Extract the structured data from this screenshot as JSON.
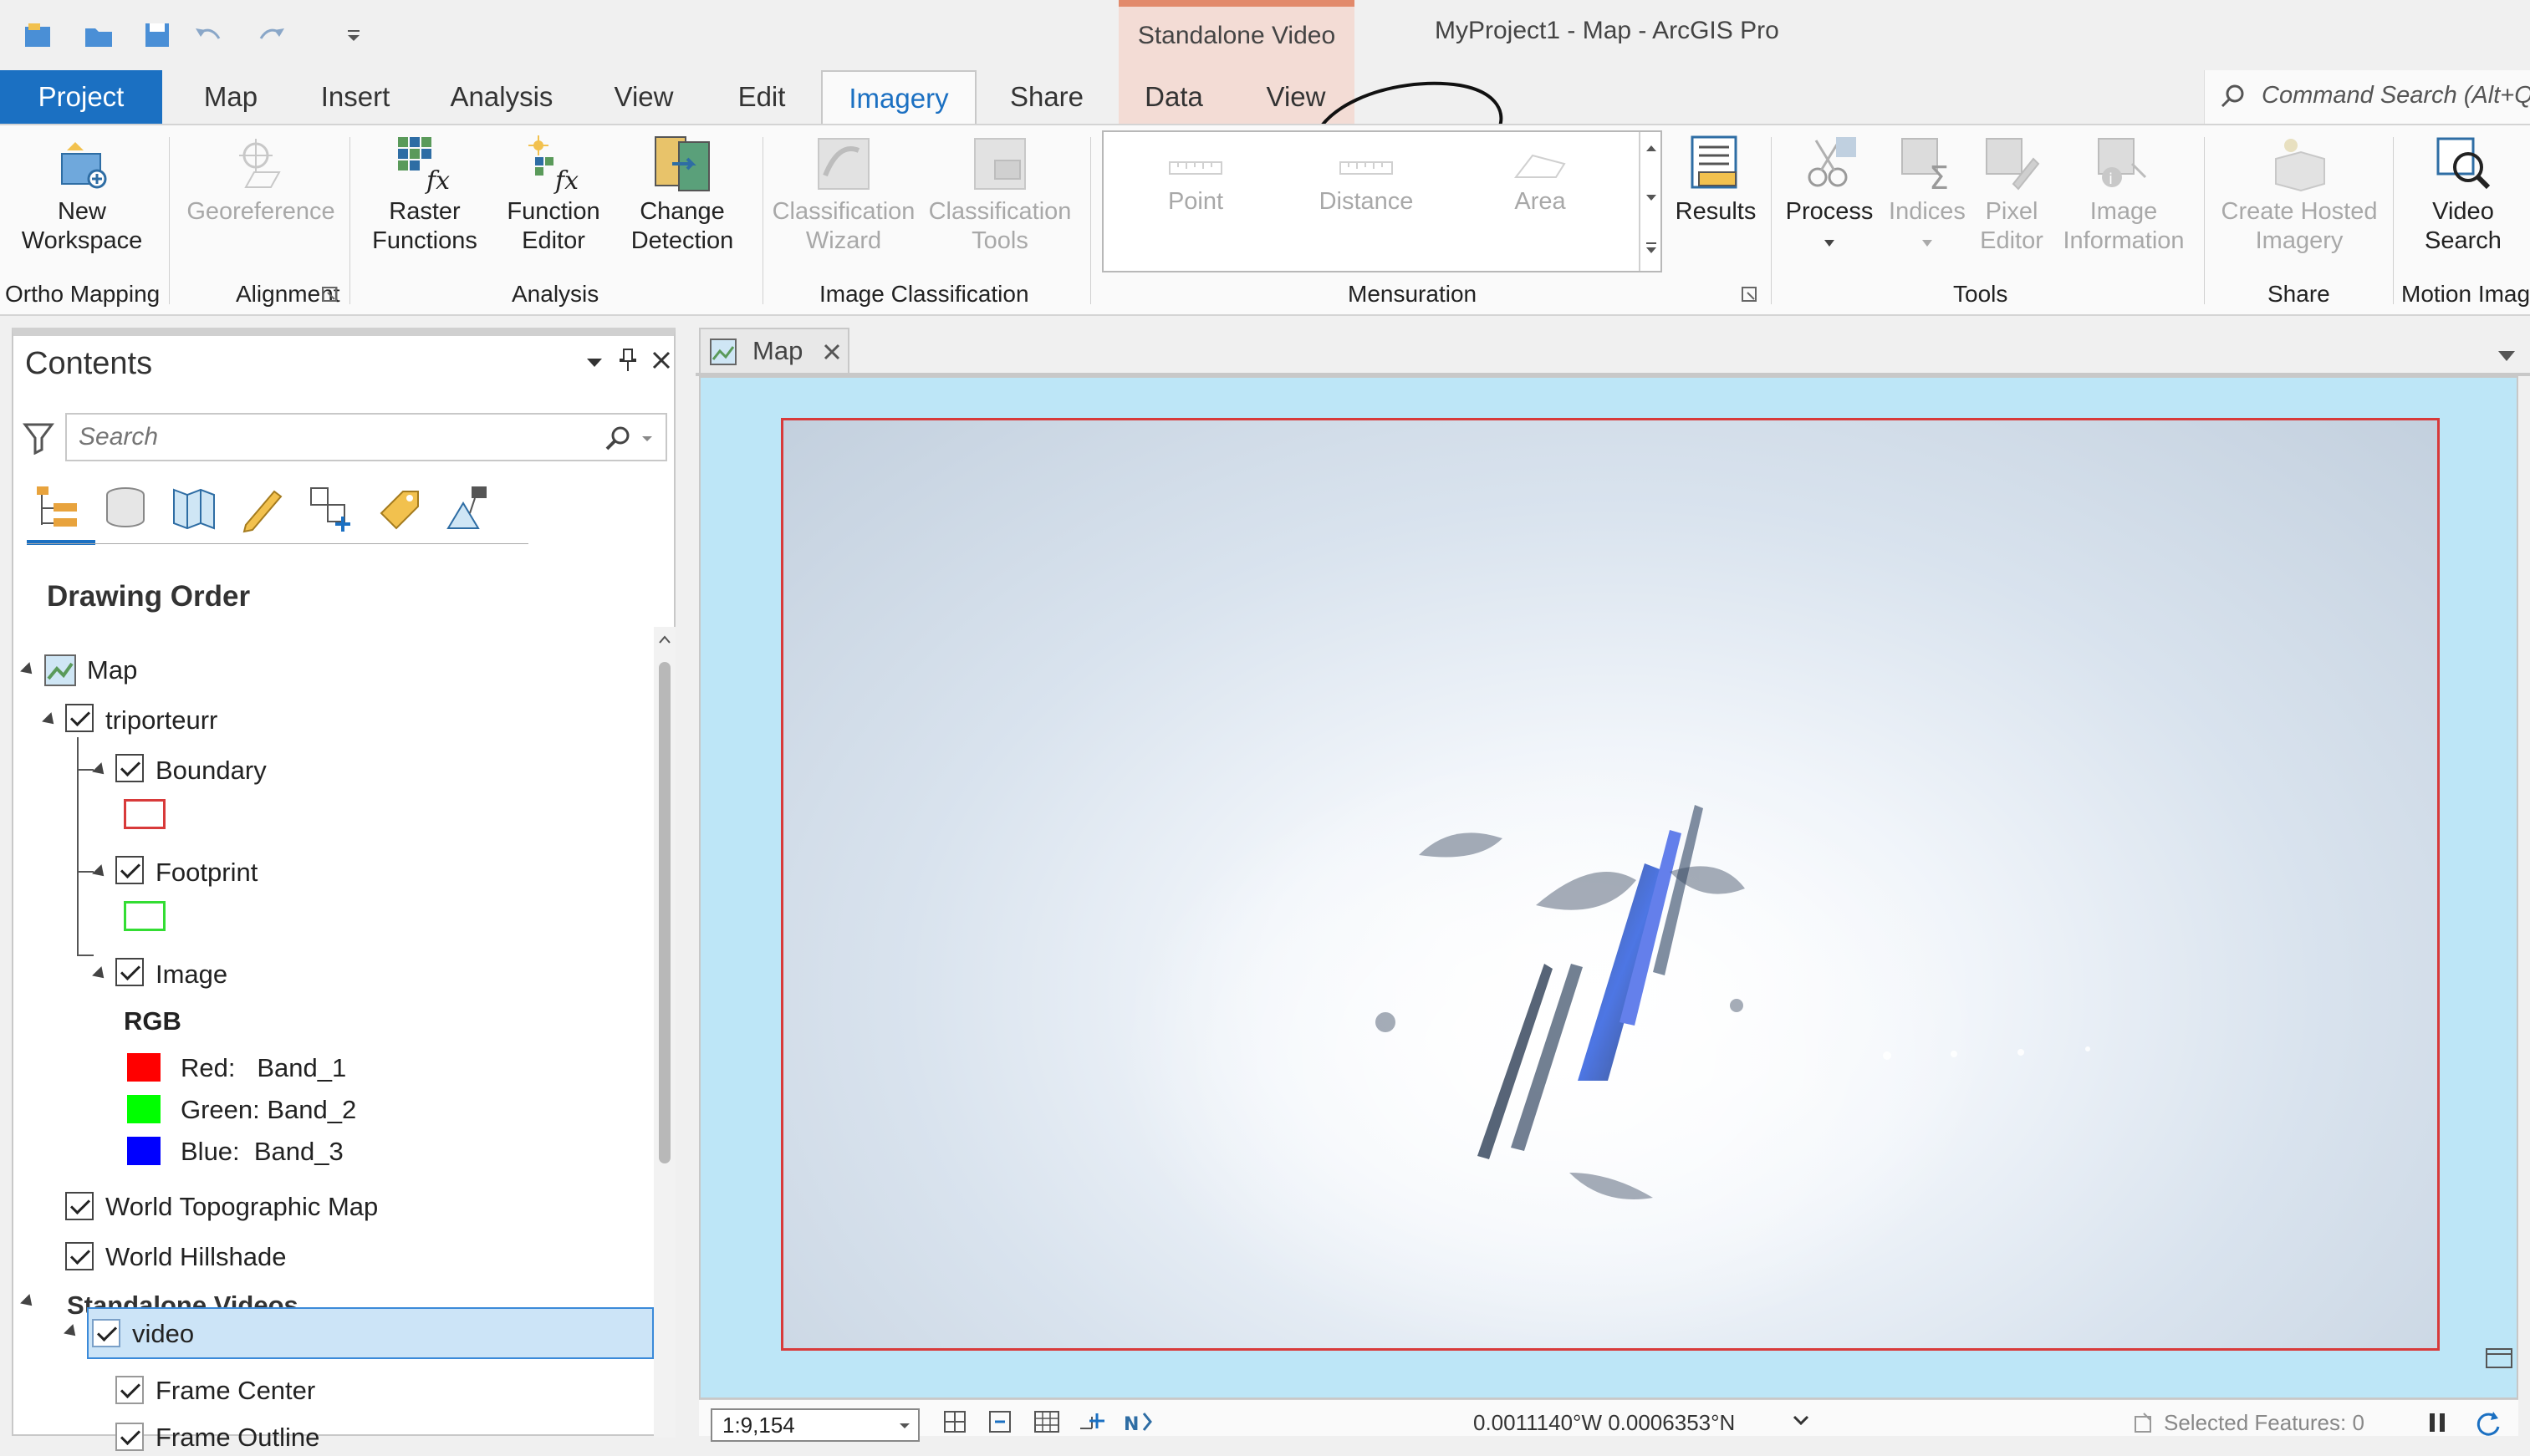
{
  "window": {
    "app_title": "MyProject1 - Map - ArcGIS Pro",
    "contextual_tab_group": "Standalone Video"
  },
  "tabs": {
    "project": "Project",
    "map": "Map",
    "insert": "Insert",
    "analysis": "Analysis",
    "view": "View",
    "edit": "Edit",
    "imagery": "Imagery",
    "share": "Share",
    "ctx_data": "Data",
    "ctx_view": "View"
  },
  "command_search": {
    "placeholder": "Command Search (Alt+Q"
  },
  "ribbon": {
    "new_workspace_1": "New",
    "new_workspace_2": "Workspace",
    "georeference": "Georeference",
    "raster_functions_1": "Raster",
    "raster_functions_2": "Functions",
    "function_editor_1": "Function",
    "function_editor_2": "Editor",
    "change_detection_1": "Change",
    "change_detection_2": "Detection",
    "classification_wizard_1": "Classification",
    "classification_wizard_2": "Wizard",
    "classification_tools_1": "Classification",
    "classification_tools_2": "Tools",
    "point": "Point",
    "distance": "Distance",
    "area": "Area",
    "results": "Results",
    "process": "Process",
    "indices": "Indices",
    "pixel_editor_1": "Pixel",
    "pixel_editor_2": "Editor",
    "image_information_1": "Image",
    "image_information_2": "Information",
    "create_hosted_imagery_1": "Create Hosted",
    "create_hosted_imagery_2": "Imagery",
    "video_search_1": "Video",
    "video_search_2": "Search",
    "groups": {
      "ortho_mapping": "Ortho Mapping",
      "alignment": "Alignment",
      "analysis": "Analysis",
      "image_classification": "Image Classification",
      "mensuration": "Mensuration",
      "tools": "Tools",
      "share": "Share",
      "motion_imagery": "Motion Imag"
    }
  },
  "contents": {
    "title": "Contents",
    "search_placeholder": "Search",
    "drawing_order": "Drawing Order",
    "tree": {
      "map": "Map",
      "triporteurr": "triporteurr",
      "boundary": "Boundary",
      "footprint": "Footprint",
      "image": "Image",
      "rgb": "RGB",
      "red": "Red:   Band_1",
      "green": "Green: Band_2",
      "blue": "Blue:  Band_3",
      "world_topo": "World Topographic Map",
      "world_hillshade": "World Hillshade",
      "standalone_videos": "Standalone Videos",
      "video": "video",
      "frame_center": "Frame Center",
      "frame_outline": "Frame Outline"
    }
  },
  "map_pane": {
    "tab_label": "Map",
    "scale": "1:9,154",
    "coords": "0.0011140°W 0.0006353°N",
    "selected_features": "Selected Features: 0"
  },
  "colors": {
    "accent": "#1b70c2",
    "context_tab": "#f3dcd5",
    "map_bg": "#bde6f7",
    "boundary_red": "#d83a3a",
    "band_red": "#ff0000",
    "band_green": "#00ff00",
    "band_blue": "#0000ff"
  }
}
